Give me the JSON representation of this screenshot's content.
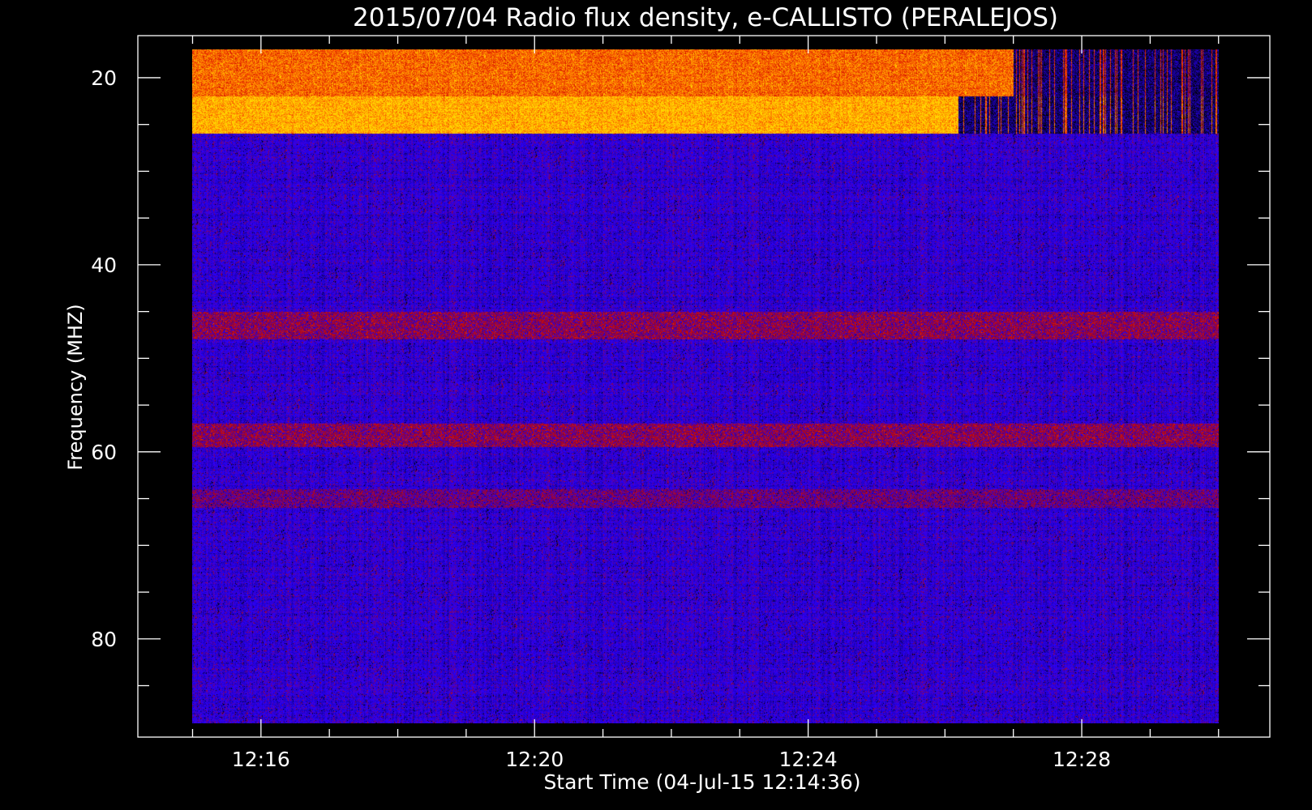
{
  "chart_data": {
    "type": "heatmap",
    "title": "2015/07/04  Radio flux density, e-CALLISTO (PERALEJOS)",
    "xlabel": "Start Time (04-Jul-15 12:14:36)",
    "ylabel": "Frequency (MHZ)",
    "x_tick_labels": [
      "12:16",
      "12:20",
      "12:24",
      "12:28"
    ],
    "x_tick_minutes": [
      16,
      20,
      24,
      28
    ],
    "y_tick_labels": [
      "20",
      "40",
      "60",
      "80"
    ],
    "y_tick_values": [
      20,
      40,
      60,
      80
    ],
    "xlim_minutes": [
      14.2,
      30.75
    ],
    "ylim_mhz": [
      90.5,
      15.5
    ],
    "data_xrange_minutes": [
      15.0,
      30.0
    ],
    "data_yrange_mhz": [
      17.0,
      89.0
    ],
    "colormap": [
      "#000000",
      "#1a00a0",
      "#2a00ff",
      "#8a0040",
      "#d41000",
      "#ff6a00",
      "#ffd800"
    ],
    "background": "#000000",
    "foreground": "#ffffff",
    "bands_mhz": [
      {
        "fmin": 17.0,
        "fmax": 22.0,
        "level": 0.72,
        "fade_after_minute": 27.0
      },
      {
        "fmin": 22.0,
        "fmax": 26.0,
        "level": 0.84,
        "fade_after_minute": 26.2
      },
      {
        "fmin": 45.0,
        "fmax": 48.0,
        "level": 0.45
      },
      {
        "fmin": 57.0,
        "fmax": 59.5,
        "level": 0.45
      },
      {
        "fmin": 64.0,
        "fmax": 66.0,
        "level": 0.38
      }
    ]
  }
}
